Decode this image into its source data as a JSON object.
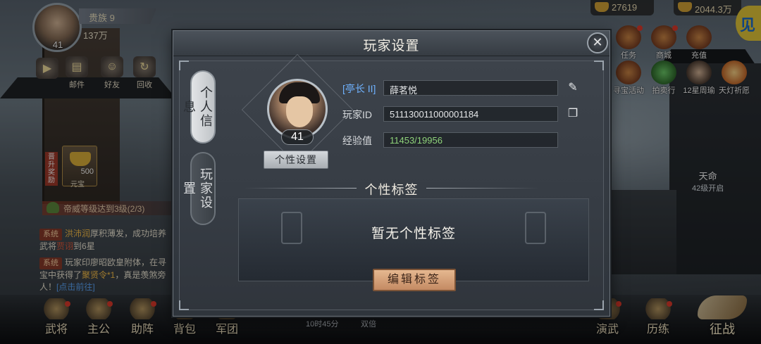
{
  "hud": {
    "player_level": "41",
    "rank_label": "贵族 9",
    "power": "137万",
    "currency_silver": "27619",
    "currency_gold": "2044.3万",
    "left_buttons": [
      {
        "label": "",
        "icon": "arrow-right-icon"
      },
      {
        "label": "邮件",
        "icon": "mail-icon"
      },
      {
        "label": "好友",
        "icon": "friends-icon"
      },
      {
        "label": "回收",
        "icon": "recycle-icon"
      }
    ],
    "yuanbao": {
      "count": "500",
      "label": "元宝"
    },
    "promo_tag": "晋升奖励",
    "quest_text": "帝威等级达到3级(2/3)",
    "chat": [
      {
        "tag": "系统",
        "name": "洪沛润",
        "text1": "厚积薄发，成功培养武将",
        "hl": "贾诩",
        "text2": "到6星"
      },
      {
        "tag": "系统",
        "text1": "玩家印廖昭欧皇附体，在寻宝中获得了",
        "name": "聚贤令*1",
        "text2": "，真是羡煞旁人！",
        "link": "[点击前往]"
      }
    ],
    "bottom_nav": [
      "武将",
      "主公",
      "助阵",
      "背包",
      "军团"
    ],
    "right_icons": [
      "任务",
      "商城",
      "充值",
      "寻宝活动",
      "拍卖行",
      "12星周瑜",
      "天灯祈愿"
    ],
    "tianming": {
      "title": "天命",
      "sub": "42级开启"
    },
    "bottom_right": [
      "演武",
      "历练"
    ],
    "fight_label": "征战",
    "timer": "10时45分",
    "double": "双倍",
    "corner_badge": "见"
  },
  "modal": {
    "title": "玩家设置",
    "tabs": [
      {
        "label": "个人信息",
        "active": true
      },
      {
        "label": "玩家设置",
        "active": false
      }
    ],
    "profile": {
      "level": "41",
      "personal_button": "个性设置",
      "rank_badge": "[亭长 II]",
      "name": "薛茗悦",
      "id_label": "玩家ID",
      "id_value": "511130011000001184",
      "exp_label": "经验值",
      "exp_value": "11453/19956"
    },
    "tags_section": {
      "title": "个性标签",
      "empty_text": "暂无个性标签",
      "edit_button": "编辑标签"
    }
  }
}
